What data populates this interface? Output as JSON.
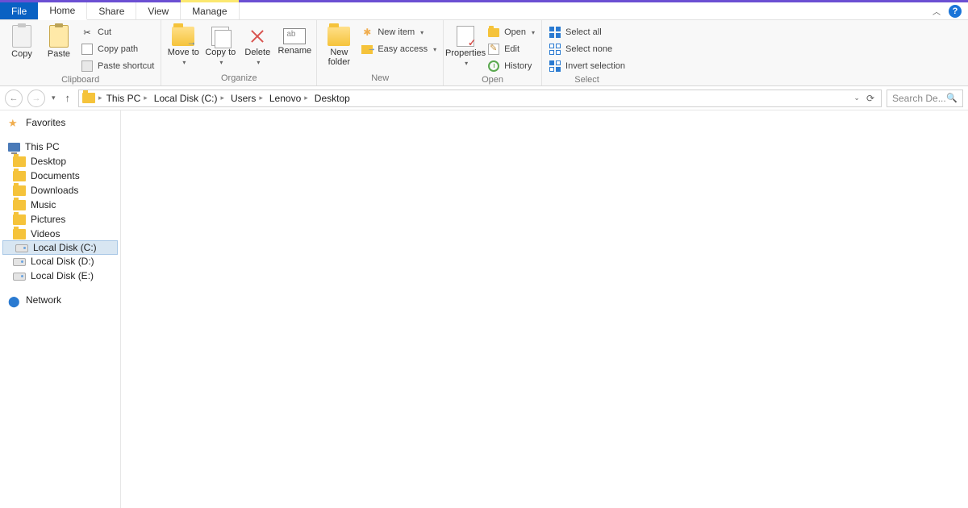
{
  "tabs": {
    "file": "File",
    "home": "Home",
    "share": "Share",
    "view": "View",
    "manage": "Manage"
  },
  "ribbon": {
    "clipboard": {
      "label": "Clipboard",
      "copy": "Copy",
      "paste": "Paste",
      "cut": "Cut",
      "copypath": "Copy path",
      "pastesc": "Paste shortcut"
    },
    "organize": {
      "label": "Organize",
      "moveto": "Move to",
      "copyto": "Copy to",
      "delete": "Delete",
      "rename": "Rename"
    },
    "new": {
      "label": "New",
      "newfolder": "New folder",
      "newitem": "New item",
      "easyaccess": "Easy access"
    },
    "open": {
      "label": "Open",
      "properties": "Properties",
      "open": "Open",
      "edit": "Edit",
      "history": "History"
    },
    "select": {
      "label": "Select",
      "all": "Select all",
      "none": "Select none",
      "invert": "Invert selection"
    }
  },
  "path": [
    "This PC",
    "Local Disk (C:)",
    "Users",
    "Lenovo",
    "Desktop"
  ],
  "search_placeholder": "Search De...",
  "nav": {
    "favorites": "Favorites",
    "thispc": "This PC",
    "items": [
      "Desktop",
      "Documents",
      "Downloads",
      "Music",
      "Pictures",
      "Videos"
    ],
    "drives": [
      "Local Disk (C:)",
      "Local Disk (D:)",
      "Local Disk (E:)"
    ],
    "network": "Network"
  }
}
